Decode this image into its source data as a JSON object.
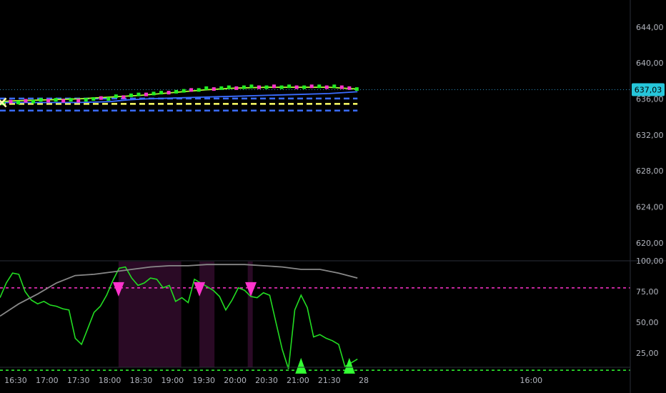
{
  "chart_data": [
    {
      "type": "line",
      "panel": "price",
      "y_range": [
        618,
        647
      ],
      "x_range": [
        16.25,
        26.3
      ],
      "last_price_label": "637,03",
      "last_price": 637.03,
      "y_ticks": [
        {
          "value": 644,
          "label": "644,00"
        },
        {
          "value": 640,
          "label": "640,00"
        },
        {
          "value": 636,
          "label": "636,00"
        },
        {
          "value": 632,
          "label": "632,00"
        },
        {
          "value": 628,
          "label": "628,00"
        },
        {
          "value": 624,
          "label": "624,00"
        },
        {
          "value": 620,
          "label": "620,00"
        }
      ],
      "x_ticks": [
        {
          "value": 16.5,
          "label": "16:30"
        },
        {
          "value": 17.0,
          "label": "17:00"
        },
        {
          "value": 17.5,
          "label": "17:30"
        },
        {
          "value": 18.0,
          "label": "18:00"
        },
        {
          "value": 18.5,
          "label": "18:30"
        },
        {
          "value": 19.0,
          "label": "19:00"
        },
        {
          "value": 19.5,
          "label": "19:30"
        },
        {
          "value": 20.0,
          "label": "20:00"
        },
        {
          "value": 20.5,
          "label": "20:30"
        },
        {
          "value": 21.0,
          "label": "21:00"
        },
        {
          "value": 21.5,
          "label": "21:30"
        },
        {
          "value": 22.05,
          "label": "28"
        },
        {
          "value": 24.72,
          "label": "16:00"
        }
      ],
      "series": [
        {
          "color": "#3a6cff",
          "x": [
            16.25,
            17.0,
            17.5,
            18.0,
            18.3,
            18.6,
            19.0,
            19.5,
            20.0,
            20.5,
            21.0,
            21.5,
            21.95
          ],
          "y": [
            635.6,
            635.6,
            635.6,
            635.7,
            635.9,
            636.0,
            636.1,
            636.2,
            636.3,
            636.4,
            636.5,
            636.6,
            636.8
          ]
        },
        {
          "color": "#aaff33",
          "x": [
            16.25,
            16.5,
            17.0,
            17.5,
            18.0,
            18.5,
            19.0,
            19.5,
            20.0,
            20.5,
            21.0,
            21.5,
            21.95
          ],
          "y": [
            635.7,
            635.8,
            635.9,
            636.0,
            636.2,
            636.4,
            636.7,
            637.0,
            637.2,
            637.3,
            637.3,
            637.3,
            637.1
          ]
        }
      ],
      "levels": [
        {
          "y": 635.45,
          "color": "#ffff66",
          "dash": "dashed"
        },
        {
          "y": 634.7,
          "color": "#3a6cff",
          "dash": "dashed"
        },
        {
          "y": 636.05,
          "color": "#3a6cff",
          "dash": "dashed"
        }
      ],
      "candles": {
        "x": [
          16.3,
          16.42,
          16.54,
          16.66,
          16.78,
          16.9,
          17.02,
          17.14,
          17.26,
          17.38,
          17.5,
          17.62,
          17.74,
          17.86,
          17.98,
          18.1,
          18.22,
          18.34,
          18.46,
          18.58,
          18.7,
          18.82,
          18.94,
          19.06,
          19.18,
          19.3,
          19.42,
          19.54,
          19.66,
          19.78,
          19.9,
          20.02,
          20.14,
          20.26,
          20.38,
          20.5,
          20.62,
          20.74,
          20.86,
          20.98,
          21.1,
          21.22,
          21.34,
          21.46,
          21.58,
          21.7,
          21.82,
          21.94
        ],
        "y": [
          635.5,
          635.7,
          635.6,
          635.8,
          635.7,
          635.9,
          635.8,
          635.9,
          635.8,
          635.9,
          635.8,
          635.9,
          636.0,
          636.1,
          636.0,
          636.3,
          636.2,
          636.4,
          636.5,
          636.5,
          636.6,
          636.7,
          636.7,
          636.8,
          636.9,
          637.0,
          637.0,
          637.2,
          637.1,
          637.2,
          637.3,
          637.2,
          637.3,
          637.4,
          637.3,
          637.3,
          637.4,
          637.3,
          637.4,
          637.3,
          637.3,
          637.4,
          637.4,
          637.3,
          637.4,
          637.3,
          637.2,
          637.1
        ],
        "dir": [
          "u",
          "d",
          "u",
          "d",
          "u",
          "u",
          "d",
          "u",
          "d",
          "u",
          "d",
          "u",
          "u",
          "d",
          "u",
          "u",
          "d",
          "u",
          "u",
          "d",
          "u",
          "u",
          "d",
          "u",
          "u",
          "d",
          "u",
          "u",
          "d",
          "u",
          "u",
          "d",
          "u",
          "u",
          "d",
          "u",
          "d",
          "u",
          "u",
          "d",
          "u",
          "d",
          "u",
          "d",
          "u",
          "d",
          "d",
          "u"
        ]
      }
    },
    {
      "type": "line",
      "panel": "oscillator",
      "y_range": [
        0,
        100
      ],
      "y_ticks": [
        {
          "value": 100,
          "label": "100,00"
        },
        {
          "value": 75,
          "label": "75,00"
        },
        {
          "value": 50,
          "label": "50,00"
        },
        {
          "value": 25,
          "label": "25,00"
        }
      ],
      "levels": [
        {
          "y": 78,
          "color": "#ff33cc",
          "dash": "dashed"
        },
        {
          "y": 11,
          "color": "#33ff33",
          "dash": "dashed"
        }
      ],
      "highlight_ranges": [
        {
          "x0": 18.14,
          "x1": 19.14
        },
        {
          "x0": 19.43,
          "x1": 19.67
        },
        {
          "x0": 20.2,
          "x1": 20.28
        }
      ],
      "series": [
        {
          "color": "#22dd22",
          "x": [
            16.25,
            16.35,
            16.45,
            16.55,
            16.65,
            16.75,
            16.85,
            16.95,
            17.05,
            17.15,
            17.25,
            17.35,
            17.45,
            17.55,
            17.65,
            17.75,
            17.85,
            17.95,
            18.05,
            18.15,
            18.25,
            18.35,
            18.45,
            18.55,
            18.65,
            18.75,
            18.85,
            18.95,
            19.05,
            19.15,
            19.25,
            19.35,
            19.45,
            19.55,
            19.65,
            19.75,
            19.85,
            19.95,
            20.05,
            20.15,
            20.25,
            20.35,
            20.45,
            20.55,
            20.65,
            20.75,
            20.85,
            20.95,
            21.05,
            21.15,
            21.25,
            21.35,
            21.45,
            21.55,
            21.65,
            21.75,
            21.85,
            21.95
          ],
          "y": [
            70,
            82,
            90,
            89,
            75,
            68,
            65,
            67,
            64,
            63,
            61,
            60,
            37,
            32,
            45,
            58,
            63,
            72,
            84,
            94,
            95,
            86,
            80,
            82,
            86,
            85,
            78,
            80,
            67,
            70,
            66,
            85,
            82,
            79,
            76,
            71,
            60,
            68,
            78,
            76,
            71,
            70,
            74,
            72,
            50,
            28,
            12,
            60,
            72,
            62,
            38,
            40,
            37,
            35,
            32,
            14,
            17,
            20
          ]
        },
        {
          "color": "#888888",
          "x": [
            16.25,
            16.55,
            16.85,
            17.15,
            17.45,
            17.75,
            18.05,
            18.35,
            18.65,
            18.95,
            19.25,
            19.55,
            19.85,
            20.15,
            20.45,
            20.75,
            21.05,
            21.35,
            21.65,
            21.95
          ],
          "y": [
            55,
            65,
            73,
            82,
            88,
            89,
            91,
            93,
            95,
            96,
            96,
            97,
            97,
            97,
            96,
            95,
            93,
            93,
            90,
            86
          ]
        }
      ],
      "markers": [
        {
          "x": 18.14,
          "y": 78,
          "type": "triangle-down",
          "color": "#ff33cc"
        },
        {
          "x": 19.43,
          "y": 78,
          "type": "triangle-down",
          "color": "#ff33cc"
        },
        {
          "x": 20.25,
          "y": 78,
          "type": "triangle-down",
          "color": "#ff33cc"
        },
        {
          "x": 21.05,
          "y": 14,
          "type": "triangle-up",
          "color": "#33ff33"
        },
        {
          "x": 21.82,
          "y": 14,
          "type": "triangle-up",
          "color": "#33ff33"
        }
      ]
    }
  ]
}
